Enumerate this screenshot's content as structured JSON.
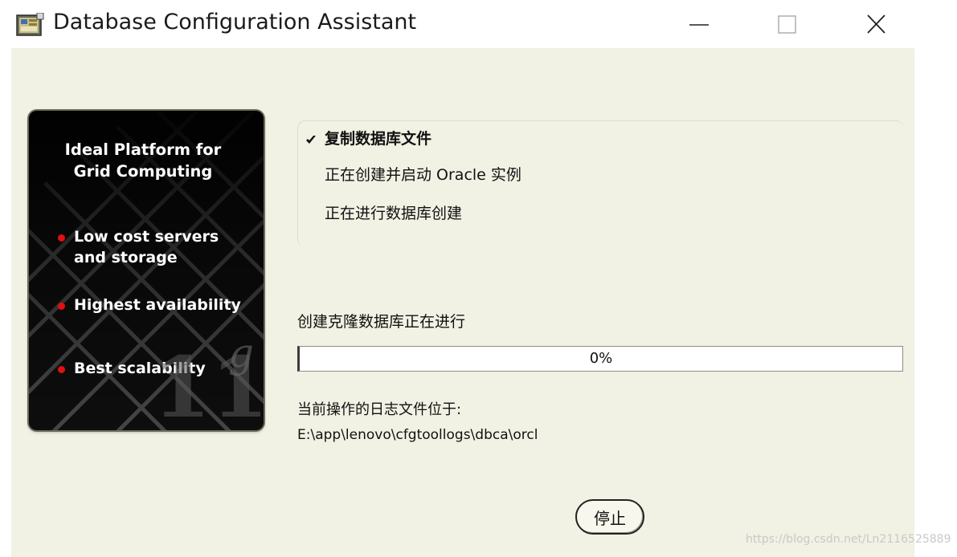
{
  "window": {
    "title": "Database Configuration Assistant",
    "icon": "dbca-app-icon",
    "controls": [
      "minimize-icon",
      "maximize-icon",
      "close-icon"
    ]
  },
  "promo": {
    "title_line1": "Ideal Platform for",
    "title_line2": "Grid Computing",
    "bullets": [
      "Low cost servers",
      "and storage",
      "Highest availability",
      "Best scalability"
    ],
    "logo_number": "11",
    "logo_letter": "g"
  },
  "steps": [
    {
      "label": "复制数据库文件",
      "status": "in-progress"
    },
    {
      "label": "正在创建并启动 Oracle 实例",
      "status": "pending"
    },
    {
      "label": "正在进行数据库创建",
      "status": "pending"
    }
  ],
  "progress": {
    "caption": "创建克隆数据库正在进行",
    "text": "0%",
    "fraction": 0
  },
  "log": {
    "caption": "当前操作的日志文件位于:",
    "path": "E:\\app\\lenovo\\cfgtoollogs\\dbca\\orcl"
  },
  "buttons": {
    "stop": "停止"
  },
  "watermark": "https://blog.csdn.net/Ln2116525889",
  "colors": {
    "client_bg": "#f1f1e4",
    "promo_bg": "#0d0d0d",
    "bullet_dot": "#e01010"
  }
}
